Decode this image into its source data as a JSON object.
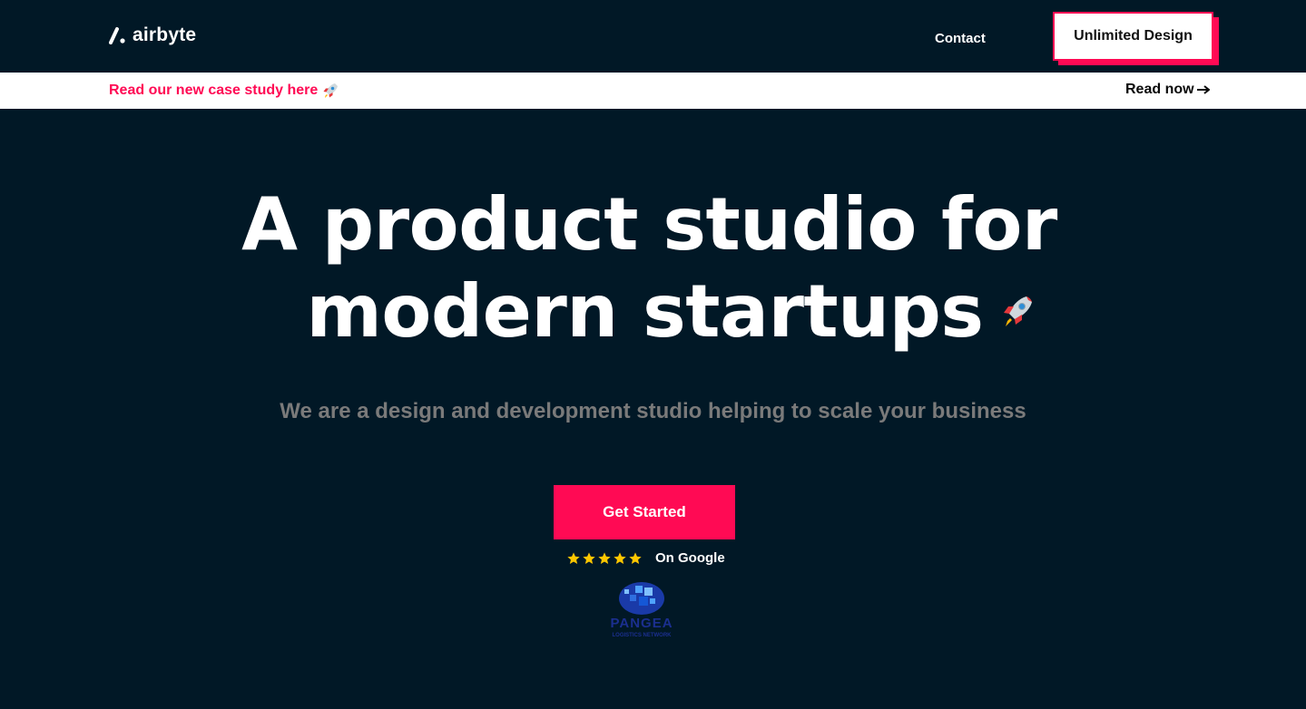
{
  "nav": {
    "logo_text": "airbyte",
    "contact_label": "Contact",
    "cta_label": "Unlimited Design"
  },
  "announcement": {
    "text": "Read our new case study here",
    "action_label": "Read now"
  },
  "hero": {
    "title_line1": "A product studio for",
    "title_line2": "modern startups",
    "subtitle": "We are a design and development studio helping to scale your business",
    "cta_label": "Get Started"
  },
  "rating": {
    "stars": 5,
    "source_text": "On Google"
  },
  "partner": {
    "name": "PANGEA",
    "tagline": "LOGISTICS NETWORK"
  },
  "colors": {
    "background": "#011826",
    "accent": "#ff0a54",
    "star": "#ffc700",
    "subtitle": "#7a7a7a"
  },
  "icons": {
    "logo_mark": "airbyte-slash-dot-icon",
    "rocket": "rocket-icon",
    "arrow": "arrow-right-icon",
    "star": "star-icon"
  }
}
